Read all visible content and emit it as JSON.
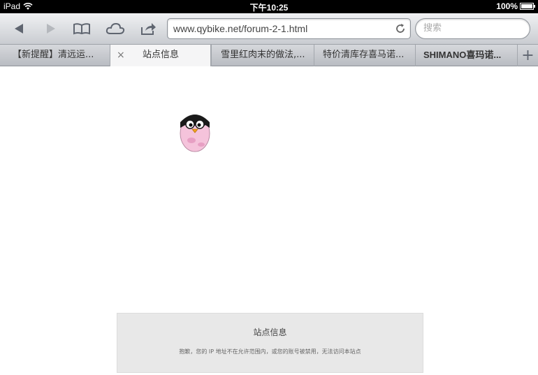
{
  "status_bar": {
    "device": "iPad",
    "time": "下午10:25",
    "battery": "100%",
    "battery_level": 1.0
  },
  "toolbar": {
    "back_icon": "back-arrow-icon",
    "forward_icon": "forward-arrow-icon",
    "bookmarks_icon": "book-icon",
    "icloud_icon": "cloud-icon",
    "share_icon": "share-icon",
    "url": "www.qybike.net/forum-2-1.html",
    "search_placeholder": "搜索"
  },
  "tabs": [
    {
      "label": "【新提醒】清远运...",
      "active": false
    },
    {
      "label": "站点信息",
      "active": true,
      "close": "×"
    },
    {
      "label": "雪里红肉末的做法,...",
      "active": false
    },
    {
      "label": "特价清库存喜马诺...",
      "active": false
    },
    {
      "label": "SHIMANO喜玛诺...",
      "active": false
    }
  ],
  "new_tab": "+",
  "message": {
    "title": "站点信息",
    "text": "抱歉，您的 IP 地址不在允许范围内，或您的账号被禁用，无法访问本站点"
  }
}
